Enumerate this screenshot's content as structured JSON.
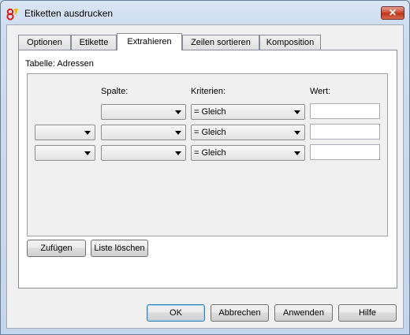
{
  "window": {
    "title": "Etiketten ausdrucken",
    "close_label": "✕"
  },
  "tabs": [
    {
      "label": "Optionen"
    },
    {
      "label": "Etikette"
    },
    {
      "label": "Extrahieren"
    },
    {
      "label": "Zeilen sortieren"
    },
    {
      "label": "Komposition"
    }
  ],
  "active_tab": "Extrahieren",
  "panel": {
    "table_label": "Tabelle: Adressen",
    "headers": {
      "spalte": "Spalte:",
      "kriterien": "Kriterien:",
      "wert": "Wert:"
    },
    "rows": [
      {
        "logic": null,
        "spalte": "",
        "kriterium": "= Gleich",
        "wert": ""
      },
      {
        "logic": "",
        "spalte": "",
        "kriterium": "= Gleich",
        "wert": ""
      },
      {
        "logic": "",
        "spalte": "",
        "kriterium": "= Gleich",
        "wert": ""
      }
    ]
  },
  "list_buttons": {
    "add": "Zufügen",
    "clear": "Liste löschen"
  },
  "footer_buttons": {
    "ok": "OK",
    "cancel": "Abbrechen",
    "apply": "Anwenden",
    "help": "Hilfe"
  },
  "icons": {
    "app": "app-logo-icon",
    "close": "close-icon",
    "dropdown": "chevron-down-icon"
  }
}
